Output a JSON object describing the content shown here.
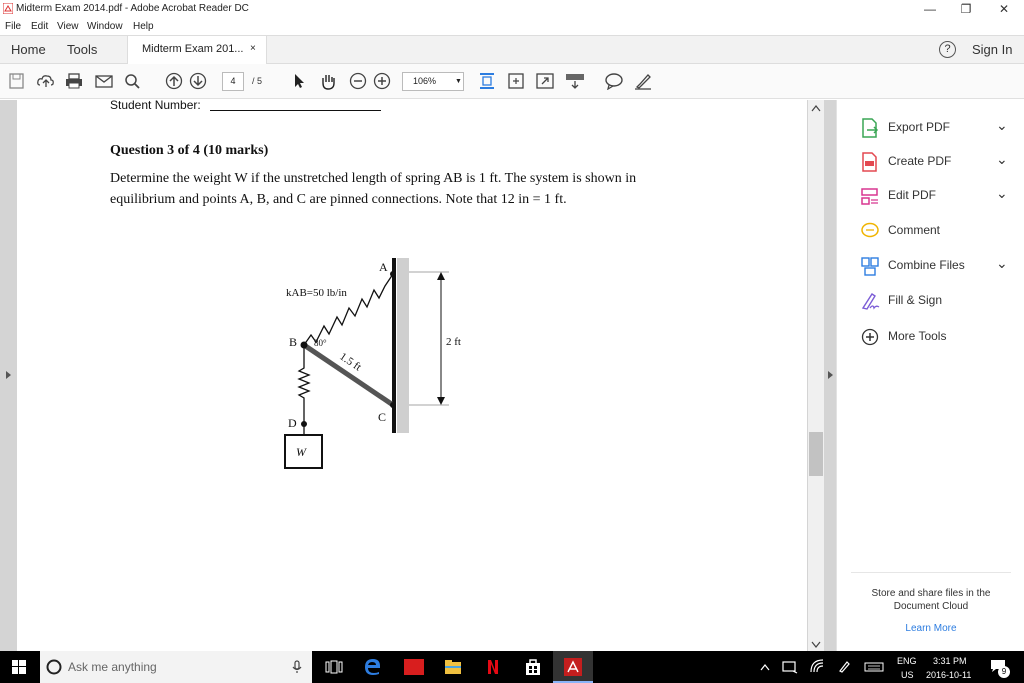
{
  "window": {
    "title": "Midterm Exam 2014.pdf - Adobe Acrobat Reader DC",
    "minimize_label": "—",
    "restore_label": "❐",
    "close_label": "✕"
  },
  "menu": [
    "File",
    "Edit",
    "View",
    "Window",
    "Help"
  ],
  "tabs": {
    "home": "Home",
    "tools": "Tools",
    "document": "Midterm Exam 201...",
    "document_close": "×",
    "help": "?",
    "sign_in": "Sign In"
  },
  "toolbar": {
    "current_page": "4",
    "total_pages": "/ 5",
    "zoom": "106%"
  },
  "document": {
    "student_number_label": "Student Number:",
    "question_heading": "Question 3 of 4 (10 marks)",
    "question_line1": "Determine the weight W if the unstretched length of spring AB is 1 ft.  The system is shown in",
    "question_line2": "equilibrium and points A, B, and C are pinned connections.  Note that 12 in = 1 ft.",
    "figure": {
      "label_A": "A",
      "label_B": "B",
      "label_C": "C",
      "label_D": "D",
      "label_W": "W",
      "spring_constant": "kAB=50 lb/in",
      "angle": "80°",
      "member_length": "1.5 ft",
      "height": "2 ft"
    }
  },
  "right_panel": {
    "tools": [
      {
        "label": "Export PDF",
        "icon": "export-pdf-icon",
        "color": "#3aa655",
        "has_chevron": true
      },
      {
        "label": "Create PDF",
        "icon": "create-pdf-icon",
        "color": "#e34850",
        "has_chevron": true
      },
      {
        "label": "Edit PDF",
        "icon": "edit-pdf-icon",
        "color": "#d83790",
        "has_chevron": true
      },
      {
        "label": "Comment",
        "icon": "comment-icon",
        "color": "#f0b400",
        "has_chevron": false
      },
      {
        "label": "Combine Files",
        "icon": "combine-files-icon",
        "color": "#2d7de0",
        "has_chevron": true
      },
      {
        "label": "Fill & Sign",
        "icon": "fill-sign-icon",
        "color": "#7b5cd6",
        "has_chevron": false
      },
      {
        "label": "More Tools",
        "icon": "more-tools-icon",
        "color": "#333333",
        "has_chevron": false
      }
    ],
    "cloud_line1": "Store and share files in the",
    "cloud_line2": "Document Cloud",
    "learn_more": "Learn More"
  },
  "taskbar": {
    "search_placeholder": "Ask me anything",
    "language": "ENG",
    "region": "US",
    "time": "3:31 PM",
    "date": "2016-10-11",
    "notification_count": "9"
  }
}
